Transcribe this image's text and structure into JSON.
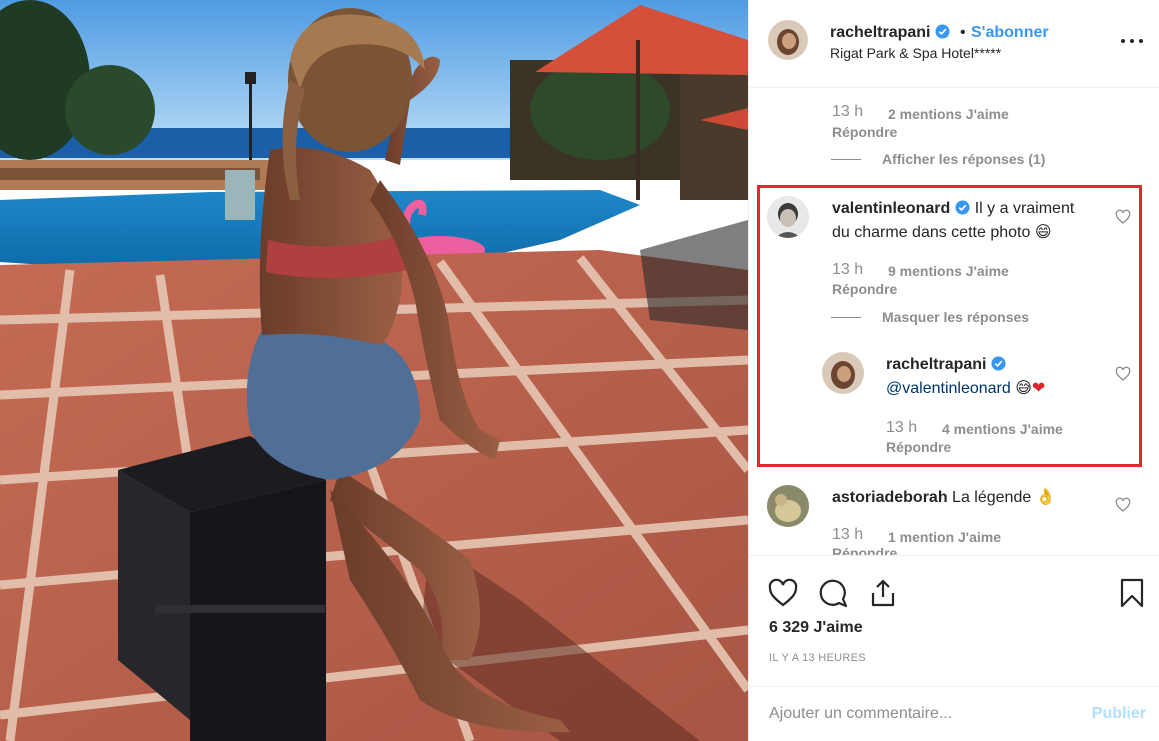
{
  "post": {
    "author": "racheltrapani",
    "separator": "•",
    "follow_label": "S'abonner",
    "location": "Rigat Park & Spa Hotel*****"
  },
  "comments": {
    "top_fragment": {
      "time": "13 h",
      "likes": "2 mentions J'aime",
      "reply": "Répondre",
      "toggle": "Afficher les réponses (1)"
    },
    "highlighted": {
      "user": "valentinleonard",
      "text_line1": "Il y a vraiment",
      "text_line2": "du charme dans cette photo",
      "emoji": "😄",
      "time": "13 h",
      "likes": "9 mentions J'aime",
      "reply": "Répondre",
      "toggle": "Masquer les réponses",
      "reply_comment": {
        "user": "racheltrapani",
        "mention": "@valentinleonard",
        "emoji1": "😅",
        "emoji2": "❤",
        "time": "13 h",
        "likes": "4 mentions J'aime",
        "reply": "Répondre"
      }
    },
    "last": {
      "user": "astoriadeborah",
      "text": "La légende",
      "emoji": "👌",
      "time": "13 h",
      "likes": "1 mention J'aime",
      "reply": "Répondre"
    }
  },
  "actions": {
    "like_icon": "heart-icon",
    "comment_icon": "comment-icon",
    "share_icon": "share-icon",
    "save_icon": "bookmark-icon"
  },
  "likes_count": "6 329 J'aime",
  "time_ago": "IL Y A 13 HEURES",
  "add_comment": {
    "placeholder": "Ajouter un commentaire...",
    "publish_label": "Publier"
  },
  "colors": {
    "link_blue": "#3897f0",
    "highlight_red": "#e0282e",
    "publish_disabled": "#b2dffc",
    "meta_gray": "#8e8e8e"
  }
}
